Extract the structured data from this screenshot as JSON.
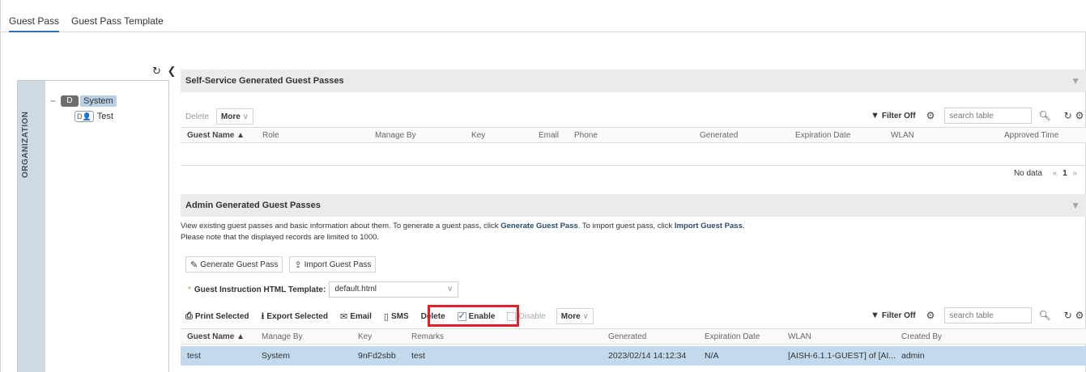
{
  "tabs": [
    {
      "label": "Guest Pass"
    },
    {
      "label": "Guest Pass Template"
    }
  ],
  "tree": {
    "org_label": "ORGANIZATION",
    "root_badge": "D",
    "root_label": "System",
    "child_badge": "D",
    "child_label": "Test",
    "collapse_sign": "−"
  },
  "self_service": {
    "title": "Self-Service Generated Guest Passes",
    "delete_label": "Delete",
    "more_label": "More",
    "filter_label": "Filter Off",
    "search_placeholder": "search table",
    "columns": [
      "Guest Name ▲",
      "Role",
      "Manage By",
      "Key",
      "Email",
      "Phone",
      "Generated",
      "Expiration Date",
      "WLAN",
      "Approved Time"
    ],
    "no_data": "No data",
    "pager_prev": "«",
    "page": "1",
    "pager_next": "»"
  },
  "admin": {
    "title": "Admin Generated Guest Passes",
    "desc_line1_a": "View existing guest passes and basic information about them. To generate a guest pass, click ",
    "desc_line1_b": "Generate Guest Pass",
    "desc_line1_c": ". To import guest pass, click ",
    "desc_line1_d": "Import Guest Pass",
    "desc_line1_e": ".",
    "desc_line2": "Please note that the displayed records are limited to 1000.",
    "generate_label": "Generate Guest Pass",
    "import_label": "Import Guest Pass",
    "template_required": "*",
    "template_label": "Guest Instruction HTML Template:",
    "template_value": "default.html",
    "toolbar": {
      "print": "Print Selected",
      "export": "Export Selected",
      "email": "Email",
      "sms": "SMS",
      "delete": "Delete",
      "enable": "Enable",
      "disable": "Disable",
      "more": "More"
    },
    "filter_label": "Filter Off",
    "search_placeholder": "search table",
    "columns": [
      "Guest Name ▲",
      "Manage By",
      "Key",
      "Remarks",
      "Generated",
      "Expiration Date",
      "WLAN",
      "Created By"
    ],
    "rows": [
      {
        "guest_name": "test",
        "manage_by": "System",
        "key": "9nFd2sbb",
        "remarks": "test",
        "generated": "2023/02/14 14:12:34",
        "expiration": "N/A",
        "wlan": "[AISH-6.1.1-GUEST] of [AI...",
        "created_by": "admin"
      }
    ]
  },
  "colors": {
    "selected_row": "#c2d9ee",
    "highlight_box": "#e1202a",
    "org_strip": "#cfd9e3"
  }
}
